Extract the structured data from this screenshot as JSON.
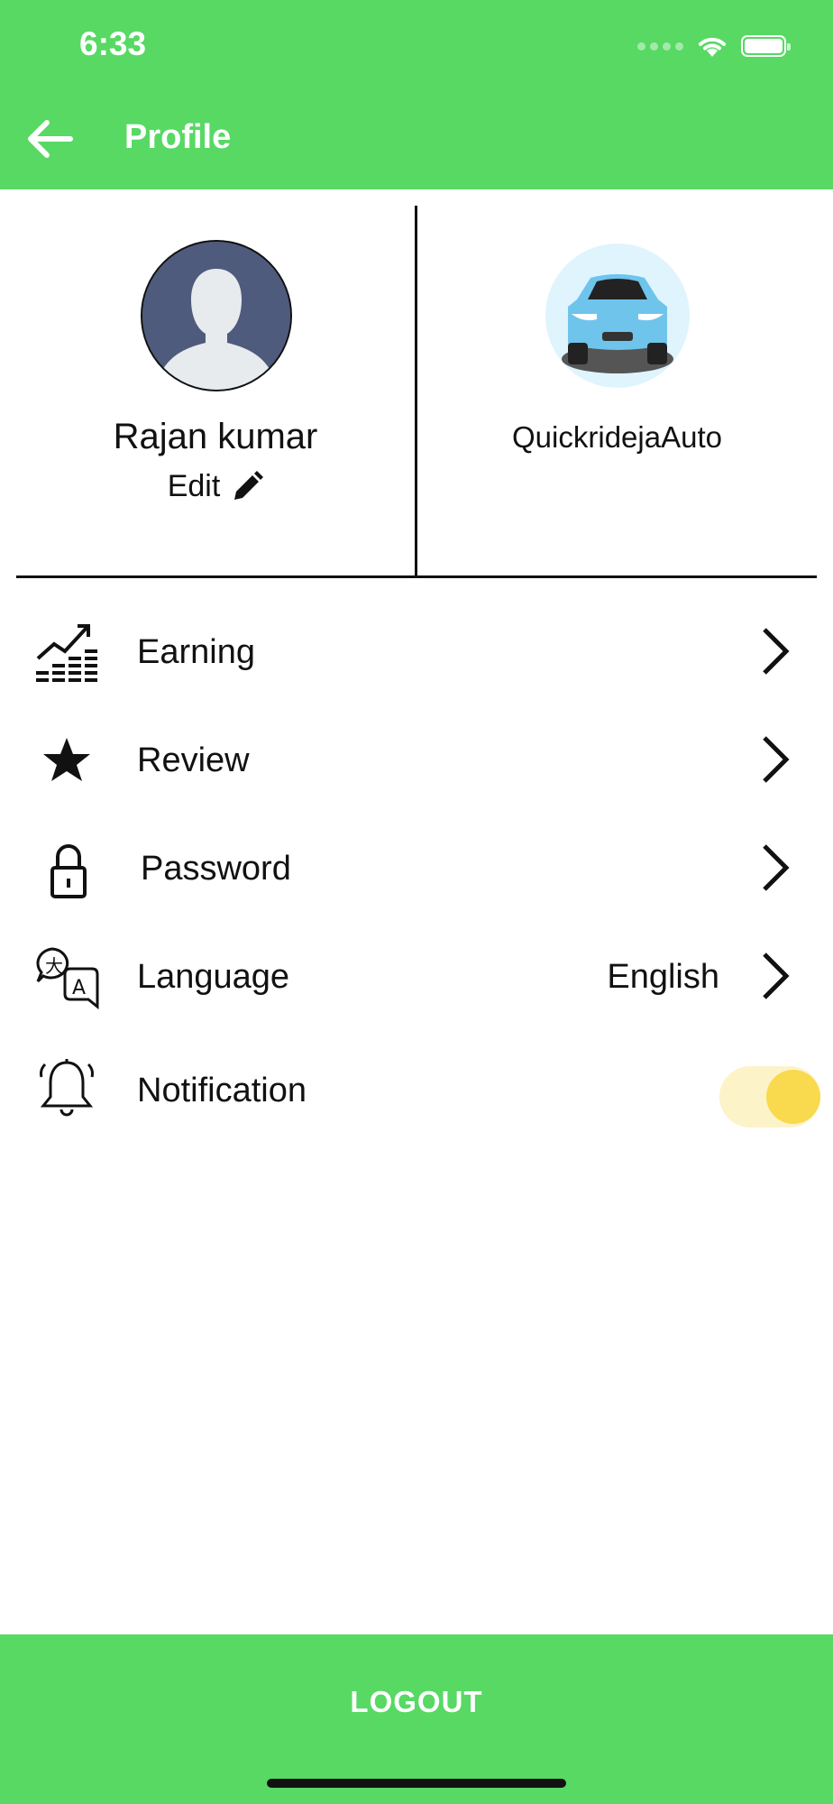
{
  "status_bar": {
    "time": "6:33"
  },
  "header": {
    "title": "Profile",
    "back_icon": "arrow-left-icon"
  },
  "profile": {
    "name": "Rajan kumar",
    "edit_label": "Edit",
    "avatar_icon": "user-avatar-icon"
  },
  "vehicle": {
    "name": "QuickridejaAuto",
    "icon": "car-icon"
  },
  "menu": {
    "items": [
      {
        "label": "Earning",
        "icon": "earning-chart-icon"
      },
      {
        "label": "Review",
        "icon": "star-icon"
      },
      {
        "label": "Password",
        "icon": "lock-icon"
      },
      {
        "label": "Language",
        "icon": "translate-icon",
        "value": "English"
      },
      {
        "label": "Notification",
        "icon": "bell-icon",
        "toggle_on": true
      }
    ]
  },
  "logout": {
    "label": "LOGOUT"
  },
  "colors": {
    "accent": "#57d964",
    "toggle_track": "#fdf3c9",
    "toggle_knob": "#f9d94d"
  }
}
